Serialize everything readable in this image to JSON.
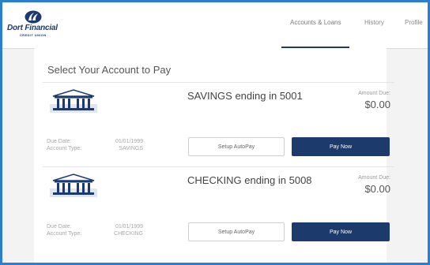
{
  "brand": {
    "name": "Dort Financial",
    "tagline": "CREDIT UNION",
    "primary_color": "#1d3a6c",
    "frame_color": "#2b7fd0"
  },
  "nav": {
    "items": [
      {
        "label": "Accounts & Loans",
        "active": true
      },
      {
        "label": "History",
        "active": false
      },
      {
        "label": "Profile",
        "active": false
      }
    ]
  },
  "main": {
    "title": "Select Your Account to Pay",
    "accounts": [
      {
        "icon": "bank-icon",
        "title": "SAVINGS ending in 5001",
        "amount_due_label": "Amount Due:",
        "amount_due": "$0.00",
        "due_date_label": "Due Date:",
        "due_date": "01/01/1999",
        "account_type_label": "Account Type:",
        "account_type": "SAVINGS",
        "autopay_label": "Setup AutoPay",
        "paynow_label": "Pay Now"
      },
      {
        "icon": "bank-icon",
        "title": "CHECKING ending in 5008",
        "amount_due_label": "Amount Due:",
        "amount_due": "$0.00",
        "due_date_label": "Due Date:",
        "due_date": "01/01/1999",
        "account_type_label": "Account Type:",
        "account_type": "CHECKING",
        "autopay_label": "Setup AutoPay",
        "paynow_label": "Pay Now"
      }
    ]
  }
}
